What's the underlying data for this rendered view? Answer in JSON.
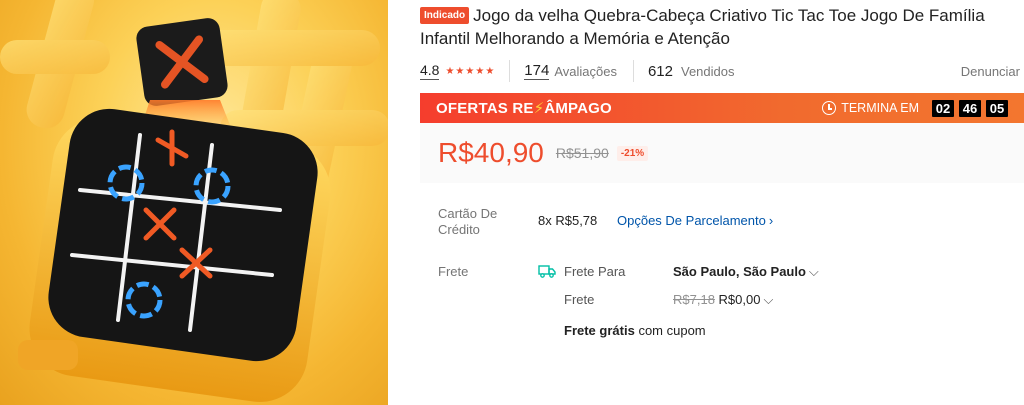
{
  "product": {
    "badge": "Indicado",
    "title": "Jogo da velha Quebra-Cabeça Criativo Tic Tac Toe Jogo De Família Infantil Melhorando a Memória e Atenção"
  },
  "stats": {
    "rating": "4.8",
    "stars": "★★★★★",
    "reviews_count": "174",
    "reviews_label": "Avaliações",
    "sold_count": "612",
    "sold_label": "Vendidos",
    "report_label": "Denunciar"
  },
  "flash_sale": {
    "title_part1": "OFERTAS RE",
    "title_bolt": "⚡",
    "title_part2": "ÂMPAGO",
    "ends_label": "TERMINA EM",
    "hours": "02",
    "minutes": "46",
    "seconds": "05"
  },
  "price": {
    "current": "R$40,90",
    "original": "R$51,90",
    "discount": "-21%"
  },
  "installments": {
    "label": "Cartão De Crédito",
    "value": "8x R$5,78",
    "options_link": "Opções De Parcelamento"
  },
  "shipping": {
    "label": "Frete",
    "to_label": "Frete Para",
    "destination": "São Paulo, São Paulo",
    "cost_label": "Frete",
    "cost_original": "R$7,18",
    "cost_current": "R$0,00",
    "free_bold": "Frete grátis",
    "free_rest": "com cupom"
  },
  "colors": {
    "brand": "#ee4d2d",
    "link": "#0055aa",
    "shipping_icon": "#00bfa5"
  }
}
